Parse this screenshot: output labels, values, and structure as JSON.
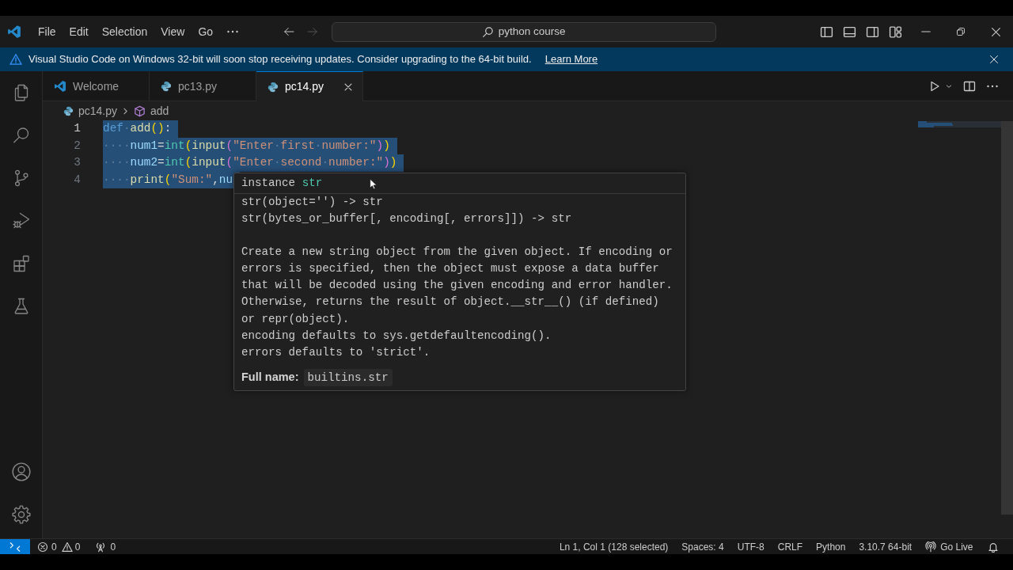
{
  "title_bar": {
    "menu": [
      {
        "label": "File"
      },
      {
        "label": "Edit"
      },
      {
        "label": "Selection"
      },
      {
        "label": "View"
      },
      {
        "label": "Go"
      }
    ],
    "nav_buttons": [
      {
        "kind": "back",
        "disabled": false
      },
      {
        "kind": "forward",
        "disabled": true
      }
    ],
    "command_center": {
      "label": "python course"
    }
  },
  "notification": {
    "message": "Visual Studio Code on Windows 32-bit will soon stop receiving updates. Consider upgrading to the 64-bit build.",
    "link": "Learn More"
  },
  "activity_bar": {
    "items": [
      {
        "kind": "explorer",
        "selected": false
      },
      {
        "kind": "search",
        "selected": false
      },
      {
        "kind": "source_control",
        "selected": false
      },
      {
        "kind": "run_debug",
        "selected": false
      },
      {
        "kind": "extensions",
        "selected": false
      },
      {
        "kind": "testing",
        "selected": false
      }
    ]
  },
  "tabs": [
    {
      "label": "Welcome",
      "kind": "welcome",
      "selected": false
    },
    {
      "label": "pc13.py",
      "kind": "python",
      "selected": false
    },
    {
      "label": "pc14.py",
      "kind": "python",
      "selected": true
    }
  ],
  "breadcrumbs": [
    {
      "kind": "file",
      "label": "pc14.py"
    },
    {
      "kind": "symbol",
      "label": "add"
    }
  ],
  "editor": {
    "lines": [
      {
        "number": "1",
        "current": true,
        "selected": true,
        "tokens": [
          {
            "kind": "keyword",
            "text": "def"
          },
          {
            "kind": "whitespace",
            "text": "·"
          },
          {
            "kind": "function",
            "text": "add"
          },
          {
            "kind": "bracket1",
            "text": "()"
          },
          {
            "kind": "punct",
            "text": ":"
          }
        ]
      },
      {
        "number": "2",
        "current": false,
        "selected": true,
        "tokens": [
          {
            "kind": "whitespace",
            "text": "····"
          },
          {
            "kind": "variable",
            "text": "num1"
          },
          {
            "kind": "operator",
            "text": "="
          },
          {
            "kind": "class",
            "text": "int"
          },
          {
            "kind": "bracket1",
            "text": "("
          },
          {
            "kind": "function",
            "text": "input"
          },
          {
            "kind": "bracket2",
            "text": "("
          },
          {
            "kind": "string",
            "text": "\"Enter"
          },
          {
            "kind": "whitespace",
            "text": "·"
          },
          {
            "kind": "string",
            "text": "first"
          },
          {
            "kind": "whitespace",
            "text": "·"
          },
          {
            "kind": "string",
            "text": "number:\""
          },
          {
            "kind": "bracket2",
            "text": ")"
          },
          {
            "kind": "bracket1",
            "text": ")"
          }
        ]
      },
      {
        "number": "3",
        "current": false,
        "selected": true,
        "tokens": [
          {
            "kind": "whitespace",
            "text": "····"
          },
          {
            "kind": "variable",
            "text": "num2"
          },
          {
            "kind": "operator",
            "text": "="
          },
          {
            "kind": "class",
            "text": "int"
          },
          {
            "kind": "bracket1",
            "text": "("
          },
          {
            "kind": "function",
            "text": "input"
          },
          {
            "kind": "bracket2",
            "text": "("
          },
          {
            "kind": "string",
            "text": "\"Enter"
          },
          {
            "kind": "whitespace",
            "text": "·"
          },
          {
            "kind": "string",
            "text": "second"
          },
          {
            "kind": "whitespace",
            "text": "·"
          },
          {
            "kind": "string",
            "text": "number:\""
          },
          {
            "kind": "bracket2",
            "text": ")"
          },
          {
            "kind": "bracket1",
            "text": ")"
          }
        ]
      },
      {
        "number": "4",
        "current": false,
        "selected": true,
        "tokens": [
          {
            "kind": "whitespace",
            "text": "····"
          },
          {
            "kind": "function",
            "text": "print"
          },
          {
            "kind": "bracket1",
            "text": "("
          },
          {
            "kind": "string",
            "text": "\"Sum:\""
          },
          {
            "kind": "punct",
            "text": ","
          },
          {
            "kind": "variable",
            "text": "nu"
          }
        ]
      }
    ]
  },
  "hover": {
    "header": [
      {
        "kind": "plain",
        "text": "instance "
      },
      {
        "kind": "class",
        "text": "str"
      }
    ],
    "signatures": [
      "str(object='') -> str",
      "str(bytes_or_buffer[, encoding[, errors]]) -> str"
    ],
    "doc": [
      "Create a new string object from the given object. If encoding or\nerrors is specified, then the object must expose a data buffer\nthat will be decoded using the given encoding and error handler.\nOtherwise, returns the result of object.__str__() (if defined)\nor repr(object).",
      "encoding defaults to sys.getdefaultencoding().",
      "errors defaults to 'strict'."
    ],
    "full_name": {
      "label": "Full name:",
      "value": "builtins.str"
    }
  },
  "status_bar": {
    "errors": "0",
    "warnings": "0",
    "ports": "0",
    "items": [
      {
        "kind": "text",
        "label": "Ln 1, Col 1 (128 selected)"
      },
      {
        "kind": "text",
        "label": "Spaces: 4"
      },
      {
        "kind": "text",
        "label": "UTF-8"
      },
      {
        "kind": "text",
        "label": "CRLF"
      },
      {
        "kind": "text",
        "label": "Python"
      },
      {
        "kind": "text",
        "label": "3.10.7 64-bit"
      },
      {
        "kind": "live",
        "label": "Go Live"
      }
    ]
  }
}
